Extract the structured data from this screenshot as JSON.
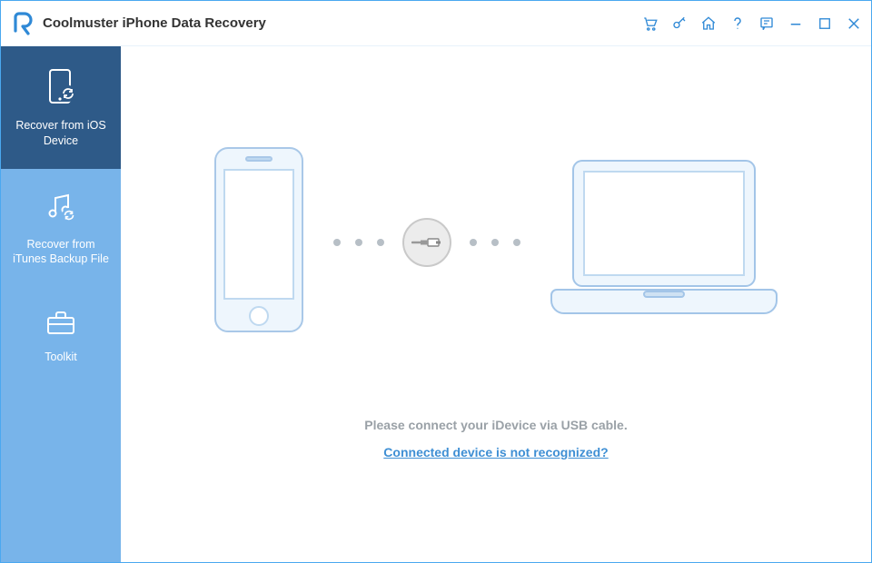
{
  "title": "Coolmuster iPhone Data Recovery",
  "sidebar": {
    "items": [
      {
        "label": "Recover from iOS\nDevice"
      },
      {
        "label": "Recover from\niTunes Backup File"
      },
      {
        "label": "Toolkit"
      }
    ]
  },
  "main": {
    "instruction": "Please connect your iDevice via USB cable.",
    "link": "Connected device is not recognized?"
  }
}
